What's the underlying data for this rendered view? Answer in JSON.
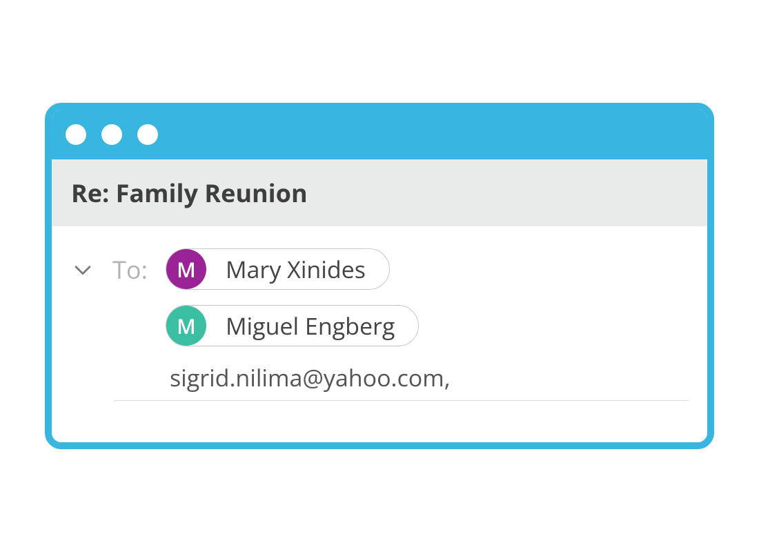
{
  "subject": "Re: Family Reunion",
  "to_label": "To:",
  "recipients": [
    {
      "initial": "M",
      "name": "Mary Xinides",
      "color": "purple"
    },
    {
      "initial": "M",
      "name": "Miguel Engberg",
      "color": "teal"
    }
  ],
  "typing": "sigrid.nilima@yahoo.com,"
}
